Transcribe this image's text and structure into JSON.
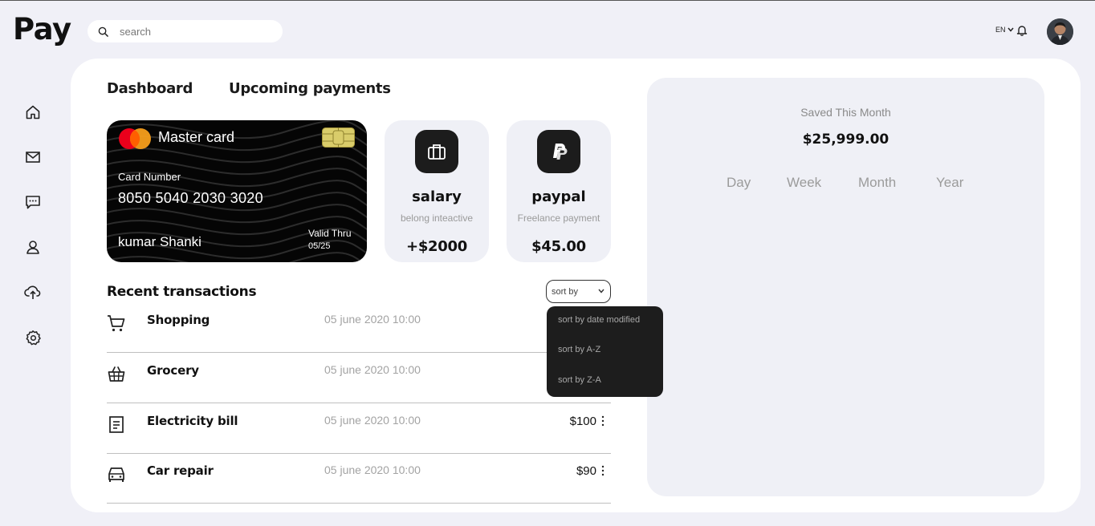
{
  "app": {
    "logo": "Pay"
  },
  "search": {
    "placeholder": "search",
    "value": ""
  },
  "header": {
    "language": "EN"
  },
  "sidebar": {
    "items": [
      {
        "name": "home",
        "icon": "home-icon"
      },
      {
        "name": "mail",
        "icon": "mail-icon"
      },
      {
        "name": "messages",
        "icon": "chat-icon"
      },
      {
        "name": "profile",
        "icon": "user-icon"
      },
      {
        "name": "upload",
        "icon": "cloud-upload-icon"
      },
      {
        "name": "settings",
        "icon": "gear-icon"
      }
    ]
  },
  "tabs": [
    "Dashboard",
    "Upcoming payments"
  ],
  "card": {
    "brand": "Master card",
    "number_label": "Card Number",
    "number": "8050 5040 2030 3020",
    "holder": "kumar Shanki",
    "valid_label": "Valid Thru",
    "valid_date": "05/25"
  },
  "tiles": [
    {
      "title": "salary",
      "subtitle": "belong inteactive",
      "amount": "+$2000",
      "icon": "briefcase-icon"
    },
    {
      "title": "paypal",
      "subtitle": "Freelance payment",
      "amount": "$45.00",
      "icon": "paypal-icon"
    }
  ],
  "transactions": {
    "title": "Recent transactions",
    "sort_label": "sort by",
    "sort_options": [
      "sort by date modified",
      "sort by A-Z",
      "sort by Z-A"
    ],
    "rows": [
      {
        "name": "Shopping",
        "date": "05 june 2020 10:00",
        "amount": "",
        "icon": "cart-icon"
      },
      {
        "name": "Grocery",
        "date": "05 june 2020 10:00",
        "amount": "",
        "icon": "basket-icon"
      },
      {
        "name": "Electricity bill",
        "date": "05 june 2020 10:00",
        "amount": "$100",
        "icon": "bill-icon"
      },
      {
        "name": "Car repair",
        "date": "05 june 2020 10:00",
        "amount": "$90",
        "icon": "car-icon"
      }
    ]
  },
  "savings": {
    "label": "Saved This Month",
    "amount": "$25,999.00",
    "periods": [
      "Day",
      "Week",
      "Month",
      "Year"
    ]
  },
  "colors": {
    "background": "#f0f0f7",
    "panel": "#ffffff",
    "tile": "#eff0f6",
    "dark": "#1c1c1c",
    "muted": "#9a9a9a"
  }
}
